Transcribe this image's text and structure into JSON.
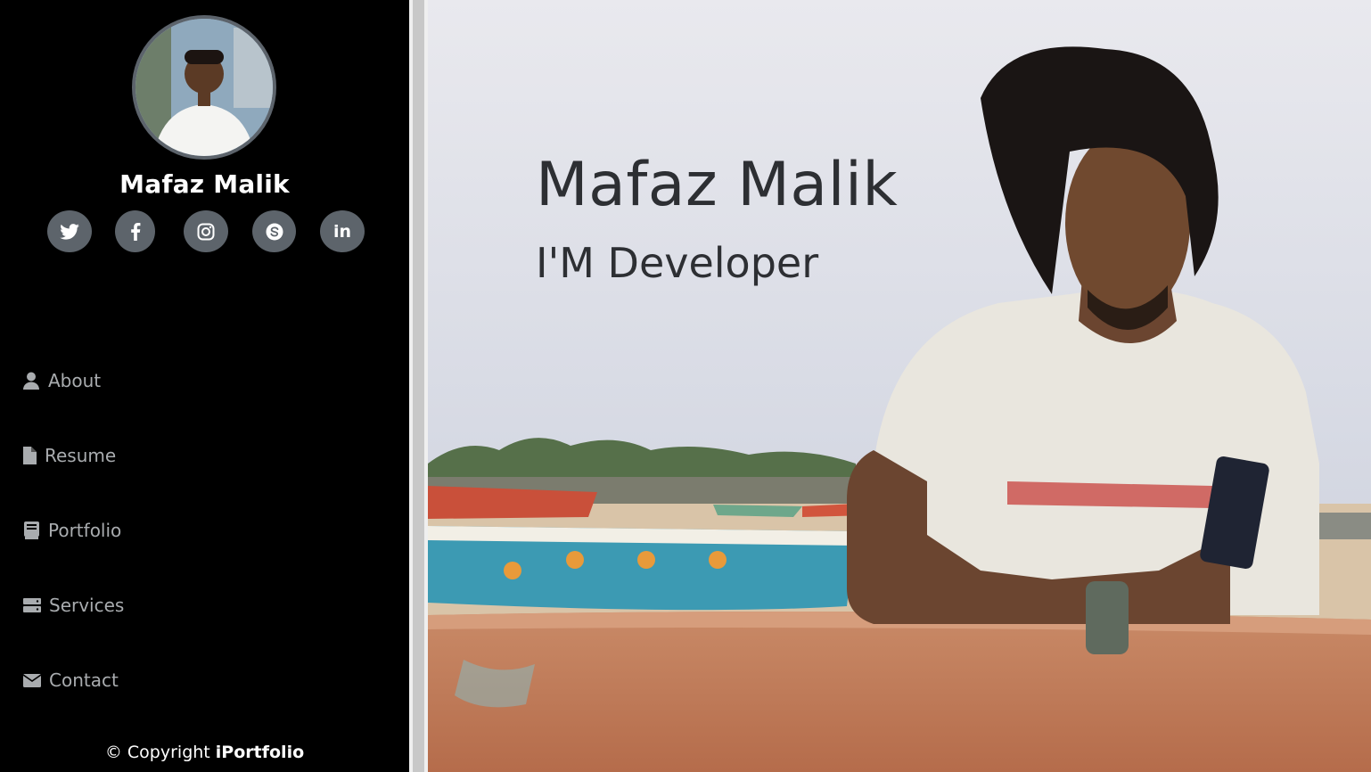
{
  "profile": {
    "name": "Mafaz Malik"
  },
  "social": [
    {
      "name": "twitter",
      "glyph": "t"
    },
    {
      "name": "facebook",
      "glyph": "f"
    },
    {
      "name": "instagram",
      "glyph": "◎"
    },
    {
      "name": "skype",
      "glyph": "S"
    },
    {
      "name": "linkedin",
      "glyph": "in"
    }
  ],
  "nav": [
    {
      "label": "About",
      "icon": "person-icon"
    },
    {
      "label": "Resume",
      "icon": "file-icon"
    },
    {
      "label": "Portfolio",
      "icon": "book-icon"
    },
    {
      "label": "Services",
      "icon": "server-icon"
    },
    {
      "label": "Contact",
      "icon": "envelope-icon"
    }
  ],
  "footer": {
    "copyright_symbol": "©",
    "copyright_text": "Copyright",
    "brand": "iPortfolio"
  },
  "hero": {
    "title": "Mafaz Malik",
    "subtitle": "I'M Developer"
  },
  "colors": {
    "sidebar_bg": "#000000",
    "social_bg": "#5d646b",
    "nav_text": "#a9acaf",
    "hero_text": "#2d2f33"
  }
}
